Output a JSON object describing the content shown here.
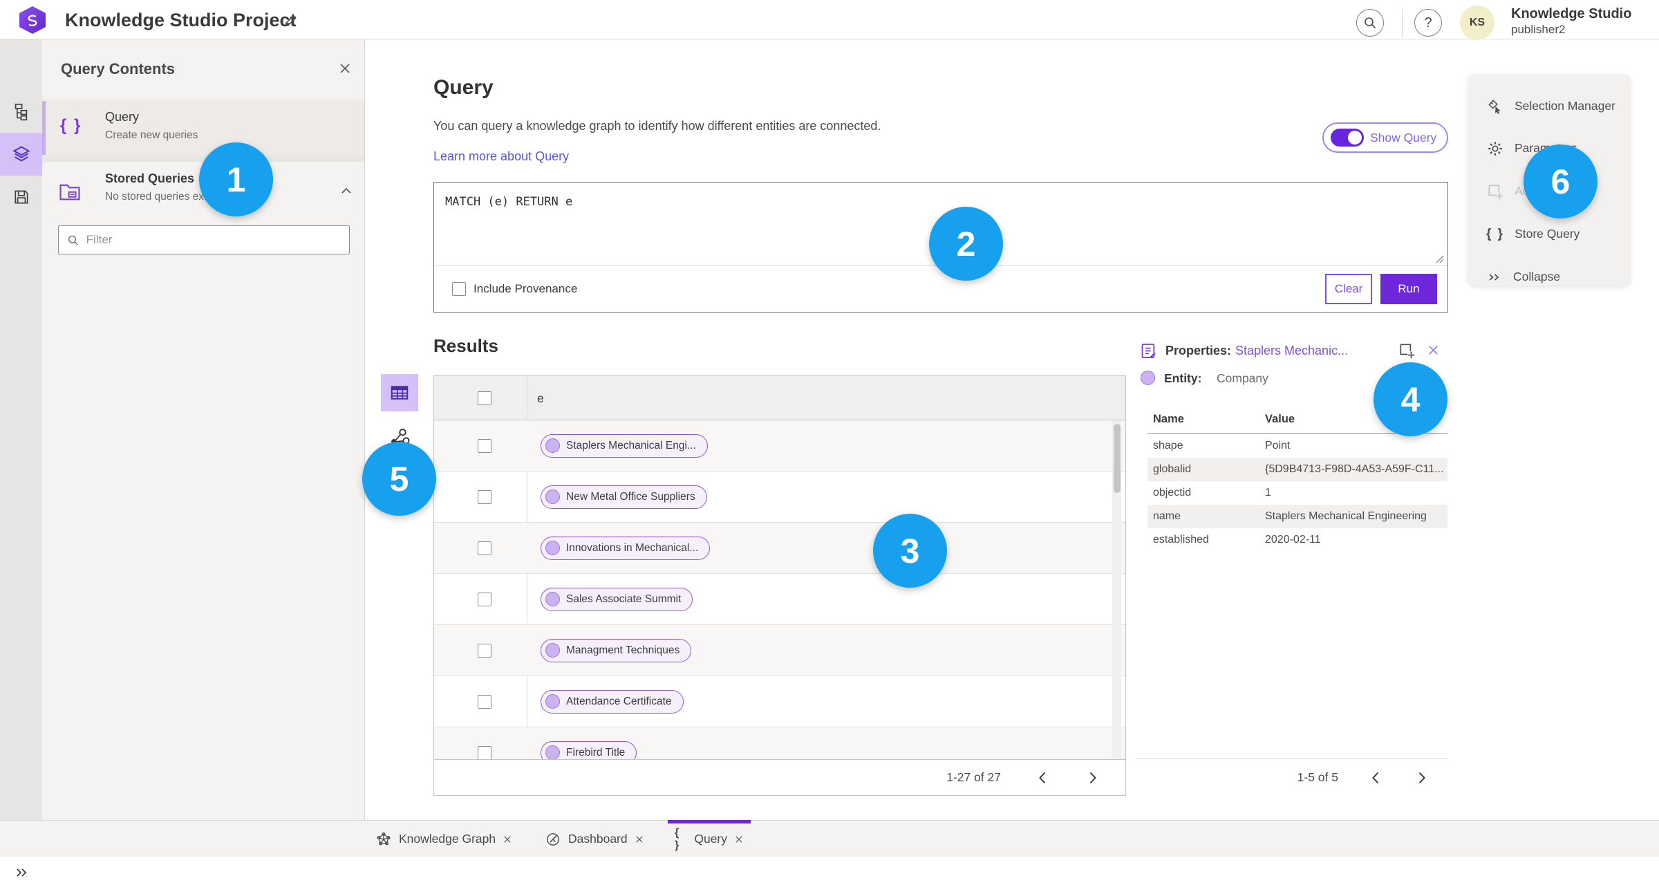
{
  "topbar": {
    "title": "Knowledge Studio Project",
    "user": {
      "name": "Knowledge Studio",
      "sub": "publisher2",
      "initials": "KS"
    }
  },
  "glyphs": {
    "braces": "{ }",
    "question": "?"
  },
  "contents": {
    "title": "Query Contents",
    "query": {
      "title": "Query",
      "subtitle": "Create new queries"
    },
    "stored": {
      "title": "Stored Queries",
      "subtitle": "No stored queries exist"
    },
    "filter_placeholder": "Filter"
  },
  "querysec": {
    "title": "Query",
    "description": "You can query a knowledge graph to identify how different entities are connected.",
    "link": "Learn more about Query",
    "toggle_label": "Show Query",
    "code": "MATCH (e) RETURN e",
    "provenance_label": "Include Provenance",
    "clear_label": "Clear",
    "run_label": "Run"
  },
  "results": {
    "title": "Results",
    "column": "e",
    "rows": [
      "Staplers Mechanical Engi...",
      "New Metal Office Suppliers",
      "Innovations in Mechanical...",
      "Sales Associate Summit",
      "Managment Techniques",
      "Attendance Certificate",
      "Firebird Title"
    ],
    "pagination": "1-27 of 27"
  },
  "props": {
    "label": "Properties:",
    "link": "Staplers Mechanic...",
    "entity_label": "Entity:",
    "entity_value": "Company",
    "col_name": "Name",
    "col_value": "Value",
    "rows": [
      {
        "name": "shape",
        "value": "Point"
      },
      {
        "name": "globalid",
        "value": "{5D9B4713-F98D-4A53-A59F-C11..."
      },
      {
        "name": "objectid",
        "value": "1"
      },
      {
        "name": "name",
        "value": "Staplers Mechanical Engineering"
      },
      {
        "name": "established",
        "value": "2020-02-11"
      }
    ],
    "pagination": "1-5 of 5"
  },
  "tools": {
    "items": [
      {
        "label": "Selection Manager"
      },
      {
        "label": "Parameters"
      },
      {
        "label": "Ad"
      },
      {
        "label": "Store Query"
      },
      {
        "label": "Collapse"
      }
    ]
  },
  "tabs": [
    {
      "label": "Knowledge Graph"
    },
    {
      "label": "Dashboard"
    },
    {
      "label": "Query"
    }
  ],
  "badges": [
    "1",
    "2",
    "3",
    "4",
    "5",
    "6"
  ],
  "colors": {
    "accent_purple": "#6e28d9",
    "badge_blue": "#16a0ee",
    "lavender": "#ccb2f1"
  }
}
